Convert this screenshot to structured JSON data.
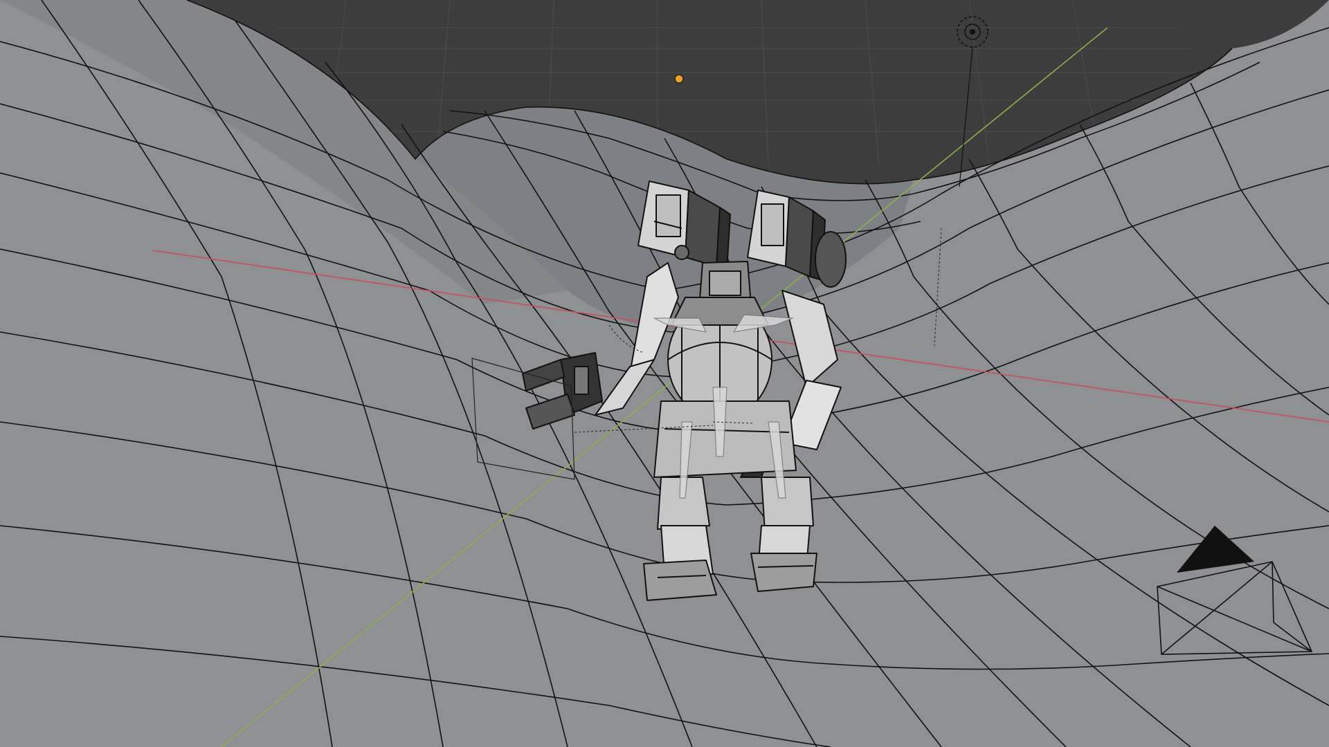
{
  "viewport": {
    "background_color": "#3d3d3d",
    "terrain_color": "#8e9094",
    "wire_color": "#111111",
    "axis_x_color": "#c8505a",
    "axis_y_color": "#8ab34a",
    "light_color": "#e8a321"
  },
  "scene_objects": [
    {
      "name": "terrain",
      "type": "mesh",
      "display": "wireframe-overlay"
    },
    {
      "name": "mech",
      "type": "mesh",
      "display": "wireframe-overlay"
    },
    {
      "name": "point-light",
      "type": "light"
    },
    {
      "name": "sun-light",
      "type": "light"
    },
    {
      "name": "camera",
      "type": "camera"
    }
  ]
}
